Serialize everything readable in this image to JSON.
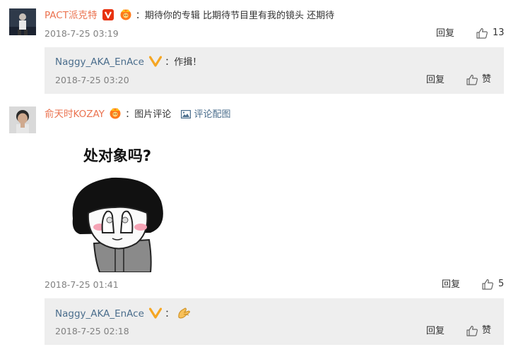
{
  "comments": [
    {
      "user": "PACT派克特",
      "text": "期待你的专辑 比期待节目里有我的镜头 还期待",
      "time": "2018-7-25 03:19",
      "reply_label": "回复",
      "like_count": "13",
      "reply": {
        "user": "Naggy_AKA_EnAce",
        "text": "作揖！",
        "time": "2018-7-25 03:20",
        "reply_label": "回复",
        "like_label": "赞"
      }
    },
    {
      "user": "俞天时KOZAY",
      "text": "图片评论",
      "image_link": "评论配图",
      "image_caption": "处对象吗?",
      "time": "2018-7-25 01:41",
      "reply_label": "回复",
      "like_count": "5",
      "reply": {
        "user": "Naggy_AKA_EnAce",
        "time": "2018-7-25 02:18",
        "reply_label": "回复",
        "like_label": "赞",
        "emoji": "clasped-hands-emoji"
      }
    }
  ],
  "colors": {
    "username_primary": "#eb7350",
    "username_reply": "#4a6d8c",
    "reply_bg": "#eeeeee",
    "timestamp": "#808080",
    "badge_red": "#e8320f",
    "badge_gold": "#f5a623"
  },
  "icons": [
    "verified-v-icon",
    "vip-crown-icon",
    "like-thumb-icon",
    "image-icon"
  ]
}
